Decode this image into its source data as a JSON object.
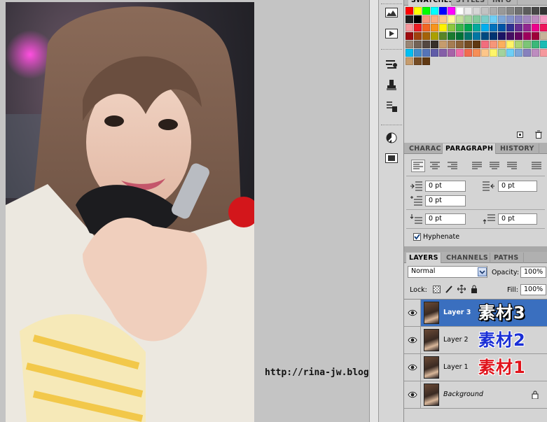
{
  "canvas": {
    "watermark": "http://rina-jw.blogspot.com/"
  },
  "tool_strip": {
    "buttons": [
      "histogram-icon",
      "play-action-icon",
      "brush-preset-icon",
      "clone-source-icon",
      "tool-presets-icon",
      "color-icon",
      "layer-comps-icon"
    ]
  },
  "swatches_panel": {
    "tabs": [
      "SWATCHES",
      "STYLES",
      "INFO"
    ],
    "active_tab": "SWATCHES",
    "colors": [
      "#ff0000",
      "#ffff00",
      "#00ff00",
      "#00ffff",
      "#0000ff",
      "#ff00ff",
      "#ffffff",
      "#ebebeb",
      "#d6d6d6",
      "#c2c2c2",
      "#adadad",
      "#999999",
      "#858585",
      "#707070",
      "#5c5c5c",
      "#474747",
      "#333333",
      "#1f1f1f",
      "#000000",
      "#f7977a",
      "#f9ad81",
      "#fdc68a",
      "#fff79a",
      "#c4df9b",
      "#a2d39c",
      "#82ca9d",
      "#7bcdc8",
      "#6ecff6",
      "#7ea7d8",
      "#8493ca",
      "#8882be",
      "#a187be",
      "#bc8dbf",
      "#f49ac2",
      "#f6989d",
      "#ed1c24",
      "#f26522",
      "#f7941d",
      "#fff200",
      "#8dc73f",
      "#39b54a",
      "#00a651",
      "#00a99d",
      "#00aeef",
      "#0072bc",
      "#0054a6",
      "#2e3192",
      "#662d91",
      "#92278f",
      "#ec008c",
      "#ed145b",
      "#9e0b0f",
      "#a0410d",
      "#a36209",
      "#aba000",
      "#598527",
      "#1a7b30",
      "#007236",
      "#00746b",
      "#0076a3",
      "#004a80",
      "#003471",
      "#1b1464",
      "#440e62",
      "#630460",
      "#9e005d",
      "#9e0039",
      "#c7b299",
      "#998675",
      "#736357",
      "#534741",
      "#37302a",
      "#c69c6d",
      "#a67c52",
      "#8c6239",
      "#754c24",
      "#603913",
      "#f26d7d",
      "#f69679",
      "#fbaf5d",
      "#fff467",
      "#acd373",
      "#7cc576",
      "#3bb878",
      "#1abbb4",
      "#00bff3",
      "#438ccb",
      "#5574b9",
      "#605ca8",
      "#855fa8",
      "#a763a8",
      "#f06ea9",
      "#f26c4f",
      "#f68e56",
      "#fdc689",
      "#fff568",
      "#a3d39c",
      "#6dcff6",
      "#7da7d9",
      "#8781bd",
      "#bd8cbf",
      "#f5989d",
      "#c69c6d",
      "#754c24",
      "#603913"
    ]
  },
  "paragraph_panel": {
    "tabs": [
      "CHARAC",
      "PARAGRAPH",
      "HISTORY"
    ],
    "active_tab": "PARAGRAPH",
    "align_buttons": [
      "align-left-icon",
      "align-center-icon",
      "align-right-icon",
      "justify-last-left-icon",
      "justify-last-center-icon",
      "justify-last-right-icon",
      "justify-all-icon"
    ],
    "indent_left": "0 pt",
    "indent_right": "0 pt",
    "indent_first_line": "0 pt",
    "space_before": "0 pt",
    "space_after": "0 pt",
    "hyphenate_label": "Hyphenate",
    "hyphenate_checked": true
  },
  "layers_panel": {
    "tabs": [
      "LAYERS",
      "CHANNELS",
      "PATHS"
    ],
    "active_tab": "LAYERS",
    "blend_mode": "Normal",
    "opacity_label": "Opacity:",
    "opacity": "100%",
    "lock_label": "Lock:",
    "fill_label": "Fill:",
    "fill": "100%",
    "layers": [
      {
        "name": "Layer 3",
        "tag": "素材3",
        "tag_color": "#ffffff",
        "selected": true
      },
      {
        "name": "Layer 2",
        "tag": "素材2",
        "tag_color": "#1a2fd6",
        "selected": false
      },
      {
        "name": "Layer 1",
        "tag": "素材1",
        "tag_color": "#e0141c",
        "selected": false
      },
      {
        "name": "Background",
        "tag": "",
        "tag_color": "",
        "selected": false,
        "locked": true
      }
    ]
  }
}
